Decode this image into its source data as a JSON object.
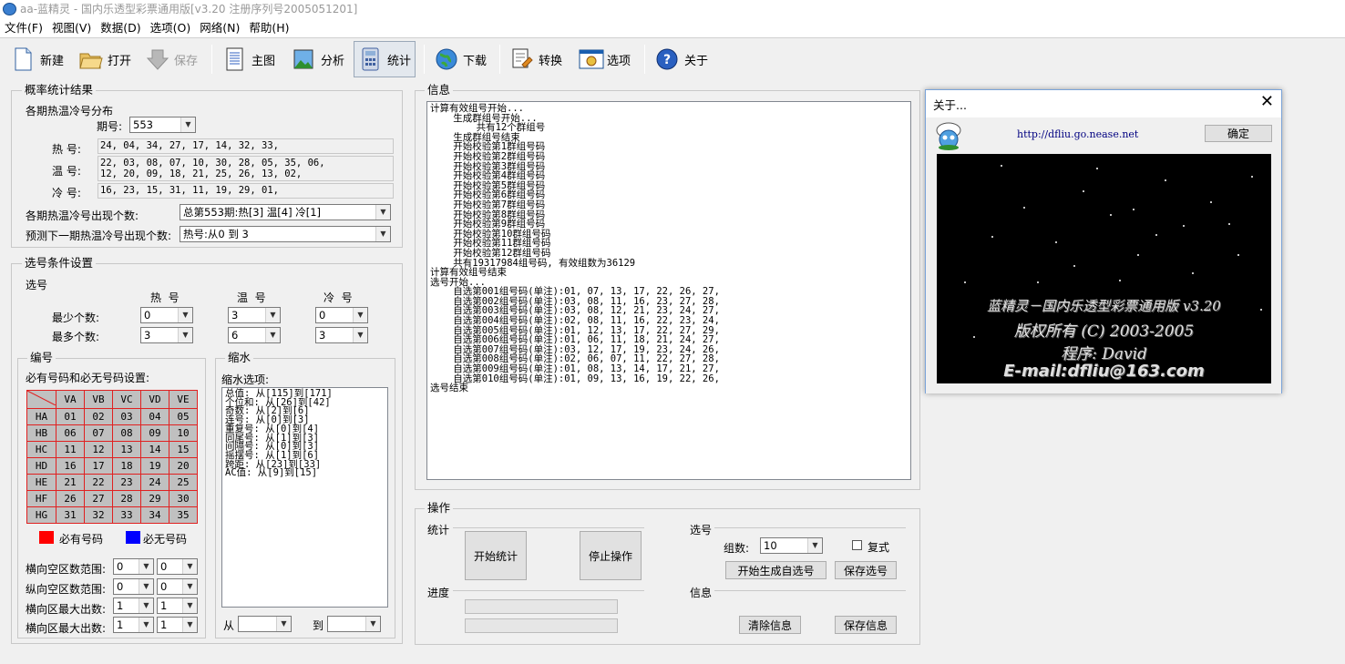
{
  "window": {
    "title": "aa-蓝精灵 - 国内乐透型彩票通用版[v3.20 注册序列号2005051201]"
  },
  "menu": [
    "文件(F)",
    "视图(V)",
    "数据(D)",
    "选项(O)",
    "网络(N)",
    "帮助(H)"
  ],
  "toolbar": {
    "new": "新建",
    "open": "打开",
    "save": "保存",
    "main_chart": "主图",
    "analysis": "分析",
    "stats": "统计",
    "download": "下载",
    "convert": "转换",
    "options": "选项",
    "about": "关于"
  },
  "prob": {
    "group_title": "概率统计结果",
    "dist_title": "各期热温冷号分布",
    "period_label": "期号:",
    "period_value": "553",
    "hot_label": "热  号:",
    "hot_value": "24, 04, 34, 27, 17, 14, 32, 33,",
    "warm_label": "温  号:",
    "warm_value": "22, 03, 08, 07, 10, 30, 28, 05, 35, 06,\n12, 20, 09, 18, 21, 25, 26, 13, 02,",
    "cold_label": "冷  号:",
    "cold_value": "16, 23, 15, 31, 11, 19, 29, 01,",
    "count_label": "各期热温冷号出现个数:",
    "count_value": "总第553期:热[3] 温[4] 冷[1]",
    "predict_label": "预测下一期热温冷号出现个数:",
    "predict_value": "热号:从0 到 3"
  },
  "cond": {
    "group_title": "选号条件设置",
    "sub_title": "选号",
    "col_hot": "热  号",
    "col_warm": "温  号",
    "col_cold": "冷  号",
    "min_label": "最少个数:",
    "max_label": "最多个数:",
    "min_values": [
      "0",
      "3",
      "0"
    ],
    "max_values": [
      "3",
      "6",
      "3"
    ]
  },
  "codes": {
    "group_title": "编号",
    "subtitle": "必有号码和必无号码设置:",
    "cols": [
      "VA",
      "VB",
      "VC",
      "VD",
      "VE"
    ],
    "rows": [
      {
        "h": "HA",
        "v": [
          "01",
          "02",
          "03",
          "04",
          "05"
        ]
      },
      {
        "h": "HB",
        "v": [
          "06",
          "07",
          "08",
          "09",
          "10"
        ]
      },
      {
        "h": "HC",
        "v": [
          "11",
          "12",
          "13",
          "14",
          "15"
        ]
      },
      {
        "h": "HD",
        "v": [
          "16",
          "17",
          "18",
          "19",
          "20"
        ]
      },
      {
        "h": "HE",
        "v": [
          "21",
          "22",
          "23",
          "24",
          "25"
        ]
      },
      {
        "h": "HF",
        "v": [
          "26",
          "27",
          "28",
          "29",
          "30"
        ]
      },
      {
        "h": "HG",
        "v": [
          "31",
          "32",
          "33",
          "34",
          "35"
        ]
      }
    ],
    "legend_must": "必有号码",
    "legend_none": "必无号码",
    "colors": {
      "must": "#ff0000",
      "none": "#0000ff",
      "grid": "#e02020"
    },
    "ranges": [
      {
        "label": "横向空区数范围:",
        "a": "0",
        "b": "0"
      },
      {
        "label": "纵向空区数范围:",
        "a": "0",
        "b": "0"
      },
      {
        "label": "横向区最大出数:",
        "a": "1",
        "b": "1"
      },
      {
        "label": "横向区最大出数:",
        "a": "1",
        "b": "1"
      }
    ]
  },
  "shrink": {
    "group_title": "缩水",
    "subtitle": "缩水选项:",
    "text": "总值: 从[115]到[171]\n个位和: 从[26]到[42]\n奇数: 从[2]到[6]\n连号: 从[0]到[3]\n重复号: 从[0]到[4]\n同尾号: 从[1]到[3]\n间隔号: 从[0]到[3]\n摇摆号: 从[1]到[6]\n跨距: 从[23]到[33]\nAC值: 从[9]到[15]",
    "from_label": "从",
    "to_label": "到"
  },
  "info": {
    "group_title": "信息",
    "log": "计算有效组号开始...\n    生成群组号开始...\n        共有12个群组号\n    生成群组号结束\n    开始校验第1群组号码\n    开始校验第2群组号码\n    开始校验第3群组号码\n    开始校验第4群组号码\n    开始校验第5群组号码\n    开始校验第6群组号码\n    开始校验第7群组号码\n    开始校验第8群组号码\n    开始校验第9群组号码\n    开始校验第10群组号码\n    开始校验第11群组号码\n    开始校验第12群组号码\n    共有19317984组号码, 有效组数为36129\n计算有效组号结束\n选号开始...\n    自选第001组号码(单注):01, 07, 13, 17, 22, 26, 27,\n    自选第002组号码(单注):03, 08, 11, 16, 23, 27, 28,\n    自选第003组号码(单注):03, 08, 12, 21, 23, 24, 27,\n    自选第004组号码(单注):02, 08, 11, 16, 22, 23, 24,\n    自选第005组号码(单注):01, 12, 13, 17, 22, 27, 29,\n    自选第006组号码(单注):01, 06, 11, 18, 21, 24, 27,\n    自选第007组号码(单注):03, 12, 17, 19, 23, 24, 26,\n    自选第008组号码(单注):02, 06, 07, 11, 22, 27, 28,\n    自选第009组号码(单注):01, 08, 13, 14, 17, 21, 27,\n    自选第010组号码(单注):01, 09, 13, 16, 19, 22, 26,\n选号结束"
  },
  "ops": {
    "group_title": "操作",
    "stat_label": "统计",
    "start_stat": "开始统计",
    "stop": "停止操作",
    "progress_label": "进度",
    "pick_label": "选号",
    "groups_label": "组数:",
    "groups_value": "10",
    "repeat_label": "复式",
    "gen": "开始生成自选号",
    "save_pick": "保存选号",
    "info_label": "信息",
    "clear_info": "清除信息",
    "save_info": "保存信息"
  },
  "about": {
    "title": "关于...",
    "url": "http://dfliu.go.nease.net",
    "ok": "确定",
    "credits": [
      "蓝精灵－国内乐透型彩票通用版 v3.20",
      "版权所有 (C) 2003-2005",
      "程序: David",
      "E-mail:dfliu@163.com"
    ]
  }
}
